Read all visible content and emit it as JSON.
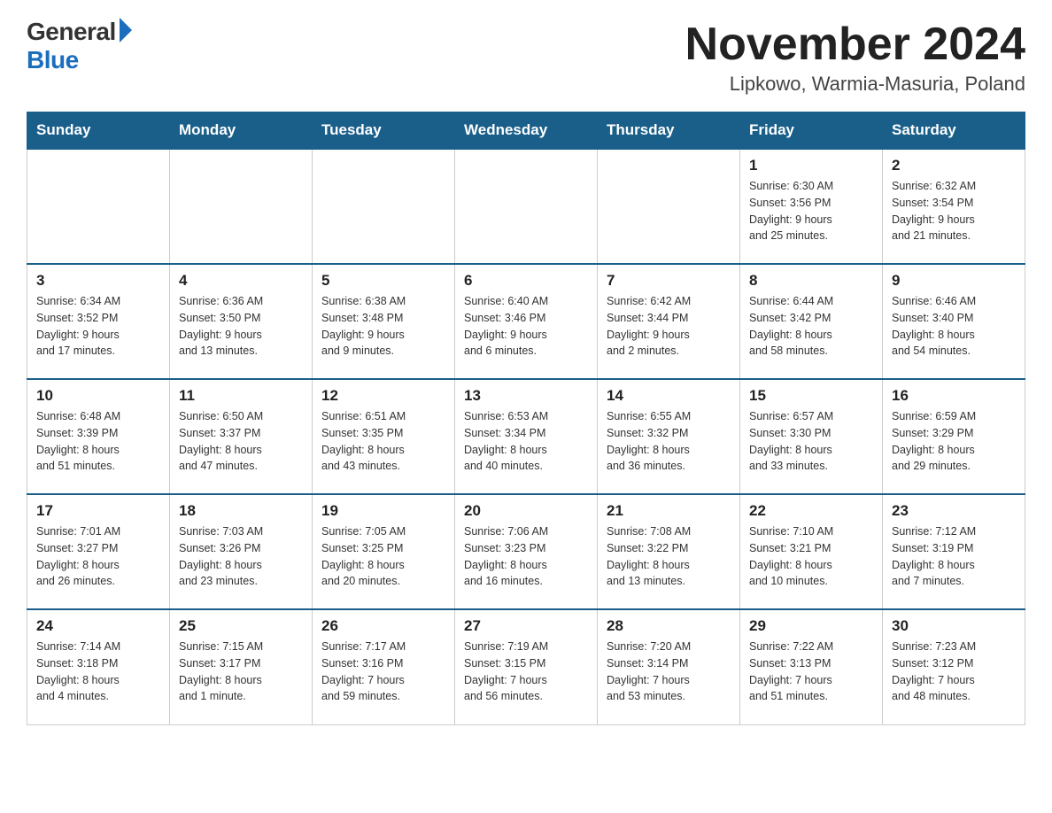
{
  "logo": {
    "general": "General",
    "blue": "Blue"
  },
  "title": "November 2024",
  "location": "Lipkowo, Warmia-Masuria, Poland",
  "days_of_week": [
    "Sunday",
    "Monday",
    "Tuesday",
    "Wednesday",
    "Thursday",
    "Friday",
    "Saturday"
  ],
  "weeks": [
    [
      {
        "day": "",
        "info": ""
      },
      {
        "day": "",
        "info": ""
      },
      {
        "day": "",
        "info": ""
      },
      {
        "day": "",
        "info": ""
      },
      {
        "day": "",
        "info": ""
      },
      {
        "day": "1",
        "info": "Sunrise: 6:30 AM\nSunset: 3:56 PM\nDaylight: 9 hours\nand 25 minutes."
      },
      {
        "day": "2",
        "info": "Sunrise: 6:32 AM\nSunset: 3:54 PM\nDaylight: 9 hours\nand 21 minutes."
      }
    ],
    [
      {
        "day": "3",
        "info": "Sunrise: 6:34 AM\nSunset: 3:52 PM\nDaylight: 9 hours\nand 17 minutes."
      },
      {
        "day": "4",
        "info": "Sunrise: 6:36 AM\nSunset: 3:50 PM\nDaylight: 9 hours\nand 13 minutes."
      },
      {
        "day": "5",
        "info": "Sunrise: 6:38 AM\nSunset: 3:48 PM\nDaylight: 9 hours\nand 9 minutes."
      },
      {
        "day": "6",
        "info": "Sunrise: 6:40 AM\nSunset: 3:46 PM\nDaylight: 9 hours\nand 6 minutes."
      },
      {
        "day": "7",
        "info": "Sunrise: 6:42 AM\nSunset: 3:44 PM\nDaylight: 9 hours\nand 2 minutes."
      },
      {
        "day": "8",
        "info": "Sunrise: 6:44 AM\nSunset: 3:42 PM\nDaylight: 8 hours\nand 58 minutes."
      },
      {
        "day": "9",
        "info": "Sunrise: 6:46 AM\nSunset: 3:40 PM\nDaylight: 8 hours\nand 54 minutes."
      }
    ],
    [
      {
        "day": "10",
        "info": "Sunrise: 6:48 AM\nSunset: 3:39 PM\nDaylight: 8 hours\nand 51 minutes."
      },
      {
        "day": "11",
        "info": "Sunrise: 6:50 AM\nSunset: 3:37 PM\nDaylight: 8 hours\nand 47 minutes."
      },
      {
        "day": "12",
        "info": "Sunrise: 6:51 AM\nSunset: 3:35 PM\nDaylight: 8 hours\nand 43 minutes."
      },
      {
        "day": "13",
        "info": "Sunrise: 6:53 AM\nSunset: 3:34 PM\nDaylight: 8 hours\nand 40 minutes."
      },
      {
        "day": "14",
        "info": "Sunrise: 6:55 AM\nSunset: 3:32 PM\nDaylight: 8 hours\nand 36 minutes."
      },
      {
        "day": "15",
        "info": "Sunrise: 6:57 AM\nSunset: 3:30 PM\nDaylight: 8 hours\nand 33 minutes."
      },
      {
        "day": "16",
        "info": "Sunrise: 6:59 AM\nSunset: 3:29 PM\nDaylight: 8 hours\nand 29 minutes."
      }
    ],
    [
      {
        "day": "17",
        "info": "Sunrise: 7:01 AM\nSunset: 3:27 PM\nDaylight: 8 hours\nand 26 minutes."
      },
      {
        "day": "18",
        "info": "Sunrise: 7:03 AM\nSunset: 3:26 PM\nDaylight: 8 hours\nand 23 minutes."
      },
      {
        "day": "19",
        "info": "Sunrise: 7:05 AM\nSunset: 3:25 PM\nDaylight: 8 hours\nand 20 minutes."
      },
      {
        "day": "20",
        "info": "Sunrise: 7:06 AM\nSunset: 3:23 PM\nDaylight: 8 hours\nand 16 minutes."
      },
      {
        "day": "21",
        "info": "Sunrise: 7:08 AM\nSunset: 3:22 PM\nDaylight: 8 hours\nand 13 minutes."
      },
      {
        "day": "22",
        "info": "Sunrise: 7:10 AM\nSunset: 3:21 PM\nDaylight: 8 hours\nand 10 minutes."
      },
      {
        "day": "23",
        "info": "Sunrise: 7:12 AM\nSunset: 3:19 PM\nDaylight: 8 hours\nand 7 minutes."
      }
    ],
    [
      {
        "day": "24",
        "info": "Sunrise: 7:14 AM\nSunset: 3:18 PM\nDaylight: 8 hours\nand 4 minutes."
      },
      {
        "day": "25",
        "info": "Sunrise: 7:15 AM\nSunset: 3:17 PM\nDaylight: 8 hours\nand 1 minute."
      },
      {
        "day": "26",
        "info": "Sunrise: 7:17 AM\nSunset: 3:16 PM\nDaylight: 7 hours\nand 59 minutes."
      },
      {
        "day": "27",
        "info": "Sunrise: 7:19 AM\nSunset: 3:15 PM\nDaylight: 7 hours\nand 56 minutes."
      },
      {
        "day": "28",
        "info": "Sunrise: 7:20 AM\nSunset: 3:14 PM\nDaylight: 7 hours\nand 53 minutes."
      },
      {
        "day": "29",
        "info": "Sunrise: 7:22 AM\nSunset: 3:13 PM\nDaylight: 7 hours\nand 51 minutes."
      },
      {
        "day": "30",
        "info": "Sunrise: 7:23 AM\nSunset: 3:12 PM\nDaylight: 7 hours\nand 48 minutes."
      }
    ]
  ]
}
